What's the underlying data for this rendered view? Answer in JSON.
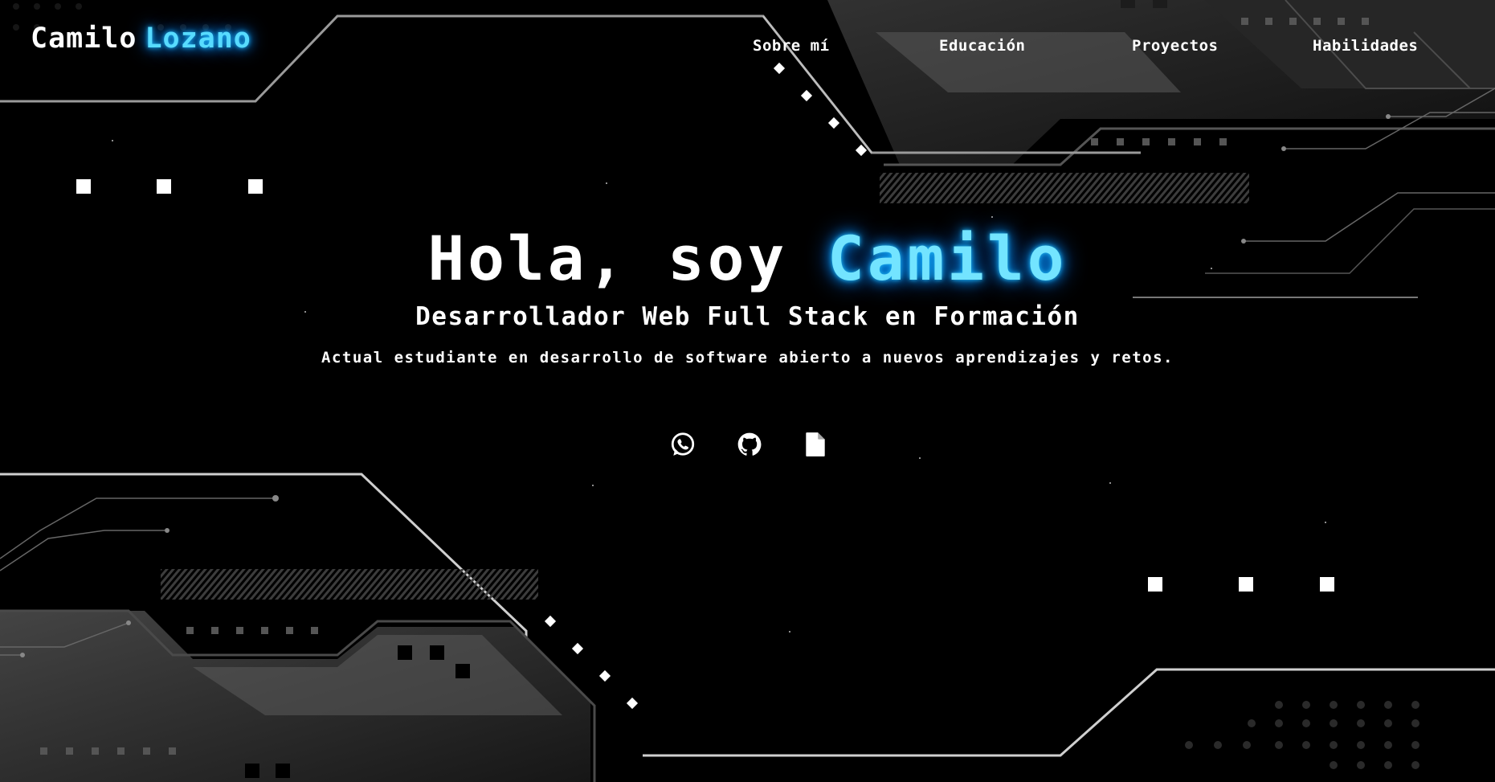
{
  "brand": {
    "first_name": "Camilo",
    "last_name": "Lozano"
  },
  "nav": {
    "items": [
      {
        "label": "Sobre mí"
      },
      {
        "label": "Educación"
      },
      {
        "label": "Proyectos"
      },
      {
        "label": "Habilidades"
      }
    ]
  },
  "hero": {
    "greeting": "Hola, soy ",
    "name": "Camilo",
    "subtitle": "Desarrollador Web Full Stack en Formación",
    "description": "Actual estudiante en desarrollo de software abierto a nuevos aprendizajes y retos."
  },
  "socials": {
    "items": [
      {
        "icon": "whatsapp-icon"
      },
      {
        "icon": "github-icon"
      },
      {
        "icon": "file-icon"
      }
    ]
  },
  "colors": {
    "accent": "#57dbff",
    "background": "#000000",
    "text": "#ffffff"
  }
}
